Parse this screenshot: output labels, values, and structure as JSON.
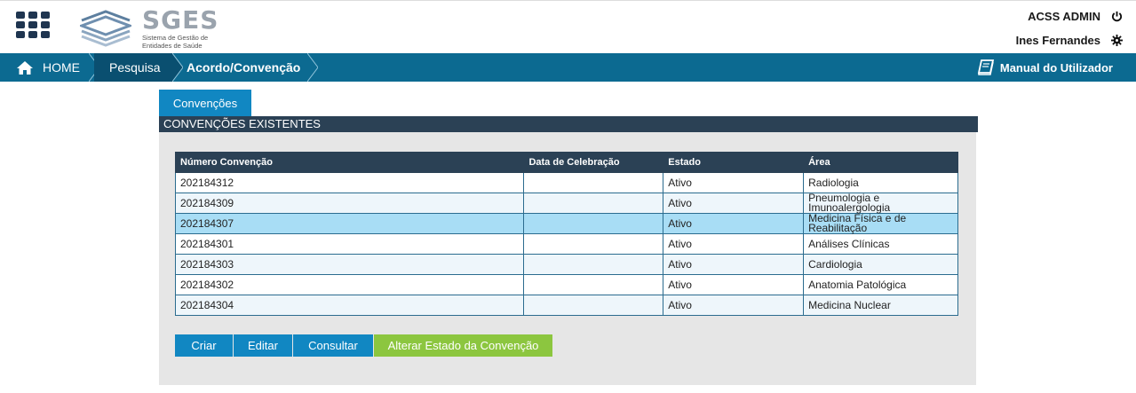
{
  "header": {
    "logo": {
      "title": "SGES",
      "subtitle": "Sistema de Gestão de Entidades de Saúde"
    },
    "user": {
      "role": "ACSS ADMIN",
      "name": "Ines Fernandes"
    },
    "icons": {
      "apps": "grid-icon",
      "power": "power-icon",
      "settings": "gear-icon"
    }
  },
  "nav": {
    "crumbs": [
      "HOME",
      "Pesquisa",
      "Acordo/Convenção"
    ],
    "manual_label": "Manual do Utilizador",
    "color": "#0c6a91"
  },
  "tabs": [
    {
      "label": "Convenções",
      "active": true
    }
  ],
  "section_title": "CONVENÇÕES EXISTENTES",
  "table": {
    "columns": [
      "Número Convenção",
      "Data de Celebração",
      "Estado",
      "Área"
    ],
    "rows": [
      {
        "numero": "202184312",
        "data": "",
        "estado": "Ativo",
        "area": "Radiologia"
      },
      {
        "numero": "202184309",
        "data": "",
        "estado": "Ativo",
        "area": "Pneumologia e Imunoalergologia"
      },
      {
        "numero": "202184307",
        "data": "",
        "estado": "Ativo",
        "area": "Medicina Física e de Reabilitação",
        "selected": true
      },
      {
        "numero": "202184301",
        "data": "",
        "estado": "Ativo",
        "area": "Análises Clínicas"
      },
      {
        "numero": "202184303",
        "data": "",
        "estado": "Ativo",
        "area": "Cardiologia"
      },
      {
        "numero": "202184302",
        "data": "",
        "estado": "Ativo",
        "area": "Anatomia Patológica"
      },
      {
        "numero": "202184304",
        "data": "",
        "estado": "Ativo",
        "area": "Medicina Nuclear"
      }
    ]
  },
  "buttons": {
    "criar": "Criar",
    "editar": "Editar",
    "consultar": "Consultar",
    "alterar": "Alterar Estado da Convenção"
  },
  "colors": {
    "accent": "#1187c2",
    "dark": "#2b4155",
    "selected_row": "#a8ddf5",
    "green_button": "#8cc63f"
  }
}
